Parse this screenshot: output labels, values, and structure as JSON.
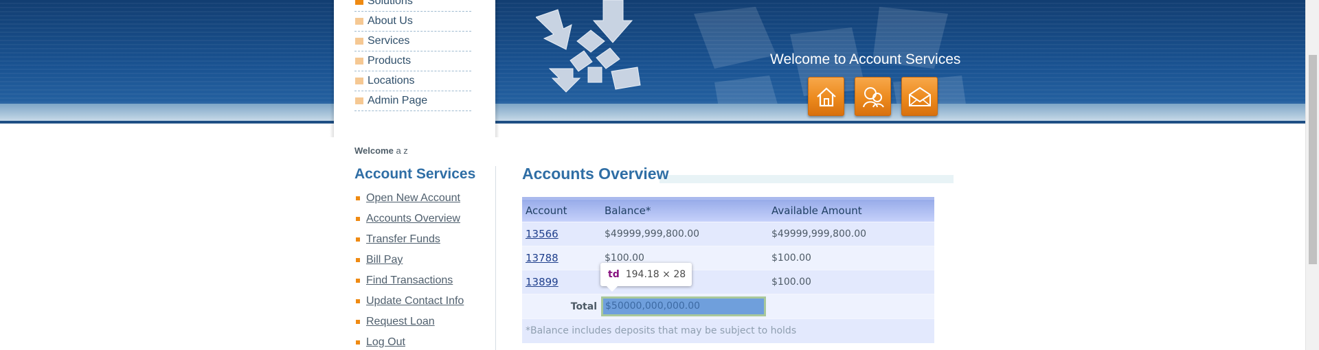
{
  "header": {
    "welcome_title": "Welcome to Account Services",
    "icons": [
      "home-icon",
      "contact-icon",
      "mail-icon"
    ],
    "accent_color": "#ec8a1d",
    "bg_color": "#1a5392"
  },
  "top_menu": {
    "items": [
      {
        "label": "Solutions"
      },
      {
        "label": "About Us"
      },
      {
        "label": "Services"
      },
      {
        "label": "Products"
      },
      {
        "label": "Locations"
      },
      {
        "label": "Admin Page"
      }
    ]
  },
  "user": {
    "welcome_label": "Welcome",
    "name": "a z"
  },
  "account_services": {
    "heading": "Account Services",
    "links": [
      {
        "label": "Open New Account"
      },
      {
        "label": "Accounts Overview"
      },
      {
        "label": "Transfer Funds"
      },
      {
        "label": "Bill Pay"
      },
      {
        "label": "Find Transactions"
      },
      {
        "label": "Update Contact Info"
      },
      {
        "label": "Request Loan"
      },
      {
        "label": "Log Out"
      }
    ]
  },
  "overview": {
    "title": "Accounts Overview",
    "columns": [
      "Account",
      "Balance*",
      "Available Amount"
    ],
    "rows": [
      {
        "account": "13566",
        "balance": "$49999,999,800.00",
        "available": "$49999,999,800.00"
      },
      {
        "account": "13788",
        "balance": "$100.00",
        "available": "$100.00"
      },
      {
        "account": "13899",
        "balance": "",
        "available": "$100.00"
      }
    ],
    "total_label": "Total",
    "total_value": "$50000,000,000.00",
    "footnote": "*Balance includes deposits that may be subject to holds"
  },
  "dev_tooltip": {
    "tag": "td",
    "dims": "194.18 × 28"
  }
}
